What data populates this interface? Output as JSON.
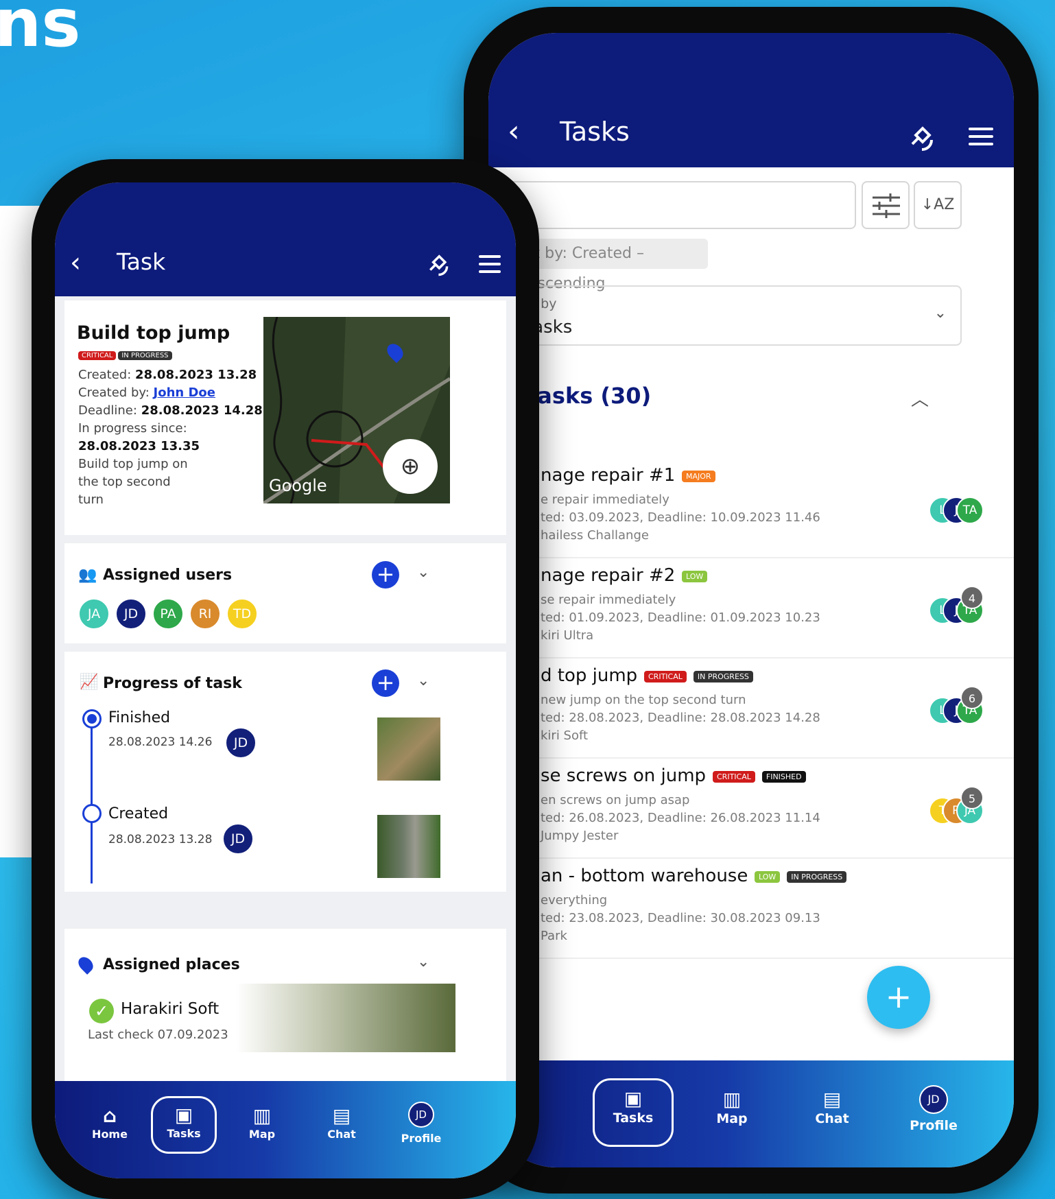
{
  "headline": "ns",
  "colors": {
    "app_bar": "#0d1b7b",
    "critical": "#d01b1b",
    "in_progress": "#333333",
    "finished": "#111111",
    "major": "#f57c1f",
    "low": "#8cc63f",
    "add": "#1a3fd6",
    "fab": "#2ebdf0"
  },
  "front": {
    "appbar": {
      "title": "Task",
      "back_icon": "chevron-left-icon",
      "satellite_icon": "satellite-icon",
      "menu_icon": "menu-icon"
    },
    "task": {
      "title": "Build top jump",
      "chips": [
        {
          "label": "CRITICAL",
          "color": "#d01b1b"
        },
        {
          "label": "IN PROGRESS",
          "color": "#333333"
        }
      ],
      "created_label": "Created:",
      "created_value": "28.08.2023 13.28",
      "created_by_label": "Created by:",
      "created_by_value": "John Doe",
      "deadline_label": "Deadline:",
      "deadline_value": "28.08.2023 14.28",
      "progress_since_label": "In progress since:",
      "progress_since_value": "28.08.2023 13.35",
      "description": [
        "Build top jump on",
        "the top second",
        "turn"
      ],
      "map_watermark": "Google"
    },
    "assigned_users": {
      "title": "Assigned users",
      "users": [
        {
          "initials": "JA",
          "color": "#3ec9b0"
        },
        {
          "initials": "JD",
          "color": "#12207a"
        },
        {
          "initials": "PA",
          "color": "#2ea84a"
        },
        {
          "initials": "RI",
          "color": "#d98a2c"
        },
        {
          "initials": "TD",
          "color": "#f5d020"
        }
      ]
    },
    "progress": {
      "title": "Progress of task",
      "entries": [
        {
          "status": "Finished",
          "time": "28.08.2023 14.26",
          "user": "JD"
        },
        {
          "status": "Created",
          "time": "28.08.2023 13.28",
          "user": "JD"
        }
      ]
    },
    "assigned_places": {
      "title": "Assigned places",
      "place": "Harakiri Soft",
      "last_check": "Last check 07.09.2023"
    },
    "nav": [
      {
        "label": "Home",
        "icon": "home-icon"
      },
      {
        "label": "Tasks",
        "icon": "tasks-icon"
      },
      {
        "label": "Map",
        "icon": "map-icon"
      },
      {
        "label": "Chat",
        "icon": "chat-icon"
      },
      {
        "label": "Profile",
        "icon": "JD"
      }
    ]
  },
  "back": {
    "appbar": {
      "title": "Tasks"
    },
    "search": {
      "placeholder": ""
    },
    "sort_label": "ort by: Created – descending",
    "group": {
      "label": "up by",
      "value": "tasks"
    },
    "section_title": "tasks (30)",
    "tasks": [
      {
        "title": "nage repair #1",
        "tags": [
          {
            "label": "MAJOR",
            "color": "#f57c1f"
          }
        ],
        "desc": "e repair immediately",
        "dates": "ted: 03.09.2023, Deadline: 10.09.2023 11.46",
        "place": "hailess Challange",
        "count": ""
      },
      {
        "title": "nage repair #2",
        "tags": [
          {
            "label": "LOW",
            "color": "#8cc63f"
          }
        ],
        "desc": "se repair immediately",
        "dates": "ted: 01.09.2023, Deadline: 01.09.2023 10.23",
        "place": "kiri Ultra",
        "count": "4"
      },
      {
        "title": "d top jump",
        "tags": [
          {
            "label": "CRITICAL",
            "color": "#d01b1b"
          },
          {
            "label": "IN PROGRESS",
            "color": "#333333"
          }
        ],
        "desc": "new jump on the top second turn",
        "dates": "ted: 28.08.2023, Deadline: 28.08.2023 14.28",
        "place": "kiri Soft",
        "count": "6"
      },
      {
        "title": "se screws on jump",
        "tags": [
          {
            "label": "CRITICAL",
            "color": "#d01b1b"
          },
          {
            "label": "FINISHED",
            "color": "#111111"
          }
        ],
        "desc": "en screws on jump asap",
        "dates": "ted: 26.08.2023, Deadline: 26.08.2023 11.14",
        "place": "Jumpy Jester",
        "count": "5"
      },
      {
        "title": "an - bottom warehouse",
        "tags": [
          {
            "label": "LOW",
            "color": "#8cc63f"
          },
          {
            "label": "IN PROGRESS",
            "color": "#333333"
          }
        ],
        "desc": "everything",
        "dates": "ted: 23.08.2023, Deadline: 30.08.2023 09.13",
        "place": "Park",
        "count": ""
      }
    ],
    "avatars": [
      [
        "L",
        "J",
        "TA"
      ],
      [
        "L",
        "J",
        "TA"
      ],
      [
        "L",
        "J",
        "TA"
      ],
      [
        "T",
        "R",
        "JA"
      ]
    ],
    "fab": "+",
    "nav": [
      {
        "label": "ome"
      },
      {
        "label": "Tasks"
      },
      {
        "label": "Map"
      },
      {
        "label": "Chat"
      },
      {
        "label": "Profile"
      }
    ],
    "profile_initials": "JD"
  }
}
